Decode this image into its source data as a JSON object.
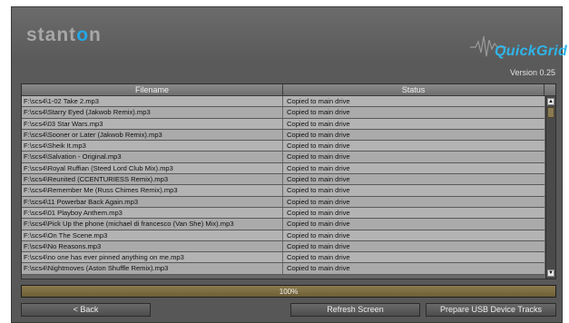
{
  "branding": {
    "logo_prefix": "stant",
    "logo_accent": "o",
    "logo_suffix": "n",
    "product": "QuickGrid",
    "version": "Version 0.25"
  },
  "grid": {
    "columns": [
      "Filename",
      "Status"
    ],
    "rows": [
      {
        "filename": "F:\\scs4\\1-02 Take 2.mp3",
        "status": "Copied to main drive"
      },
      {
        "filename": "F:\\scs4\\Starry Eyed (Jakwob Remix).mp3",
        "status": "Copied to main drive"
      },
      {
        "filename": "F:\\scs4\\03 Star Wars.mp3",
        "status": "Copied to main drive"
      },
      {
        "filename": "F:\\scs4\\Sooner or Later (Jakwob Remix).mp3",
        "status": "Copied to main drive"
      },
      {
        "filename": "F:\\scs4\\Sheik It.mp3",
        "status": "Copied to main drive"
      },
      {
        "filename": "F:\\scs4\\Salvation - Original.mp3",
        "status": "Copied to main drive"
      },
      {
        "filename": "F:\\scs4\\Royal Ruffian (Steed Lord Club Mix).mp3",
        "status": "Copied to main drive"
      },
      {
        "filename": "F:\\scs4\\Reunited (CCENTURIESS Remix).mp3",
        "status": "Copied to main drive"
      },
      {
        "filename": "F:\\scs4\\Remember Me (Russ Chimes Remix).mp3",
        "status": "Copied to main drive"
      },
      {
        "filename": "F:\\scs4\\11 Powerbar Back Again.mp3",
        "status": "Copied to main drive"
      },
      {
        "filename": "F:\\scs4\\01 Playboy Anthem.mp3",
        "status": "Copied to main drive"
      },
      {
        "filename": "F:\\scs4\\Pick Up the phone (michael di francesco (Van She) Mix).mp3",
        "status": "Copied to main drive"
      },
      {
        "filename": "F:\\scs4\\On The Scene.mp3",
        "status": "Copied to main drive"
      },
      {
        "filename": "F:\\scs4\\No Reasons.mp3",
        "status": "Copied to main drive"
      },
      {
        "filename": "F:\\scs4\\no one has ever pinned anything on me.mp3",
        "status": "Copied to main drive"
      },
      {
        "filename": "F:\\scs4\\Nightmoves (Aston Shuffle Remix).mp3",
        "status": "Copied to main drive"
      }
    ]
  },
  "progress": {
    "label": "100%",
    "fraction": 1.0
  },
  "buttons": {
    "back": "< Back",
    "refresh": "Refresh Screen",
    "prepare": "Prepare USB Device Tracks"
  },
  "colors": {
    "accent": "#2fb5ea",
    "progress": "#8b7a4d"
  },
  "icons": {
    "scroll_up": "triangle-up",
    "scroll_down": "triangle-down"
  }
}
